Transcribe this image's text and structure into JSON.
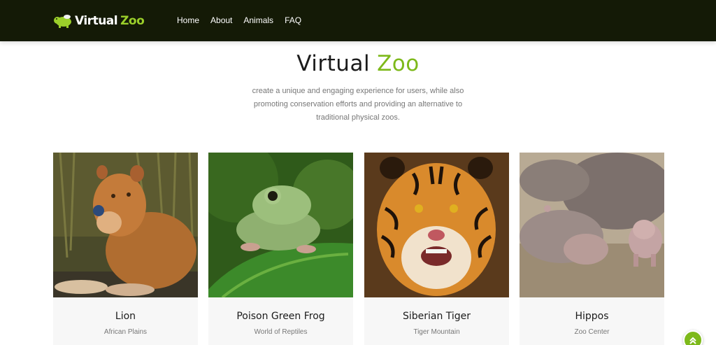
{
  "navbar": {
    "brand": {
      "word1": "Virtual",
      "word2": "Zoo"
    },
    "links": [
      "Home",
      "About",
      "Animals",
      "FAQ"
    ]
  },
  "hero": {
    "title_word1": "Virtual",
    "title_word2": "Zoo",
    "description": "create a unique and engaging experience for users, while also promoting conservation efforts and providing an alternative to traditional physical zoos."
  },
  "animals": [
    {
      "name": "Lion",
      "location": "African Plains",
      "image": "lion-photo"
    },
    {
      "name": "Poison Green Frog",
      "location": "World of Reptiles",
      "image": "frog-photo"
    },
    {
      "name": "Siberian Tiger",
      "location": "Tiger Mountain",
      "image": "tiger-photo"
    },
    {
      "name": "Hippos",
      "location": "Zoo Center",
      "image": "hippo-photo"
    }
  ],
  "colors": {
    "navbar_bg": "#141a06",
    "accent": "#7db91a",
    "text_dark": "#1b1b1b",
    "text_muted": "#777777"
  },
  "icons": {
    "back_to_top": "chevron-double-up-icon",
    "logo": "hippo-logo-icon"
  }
}
